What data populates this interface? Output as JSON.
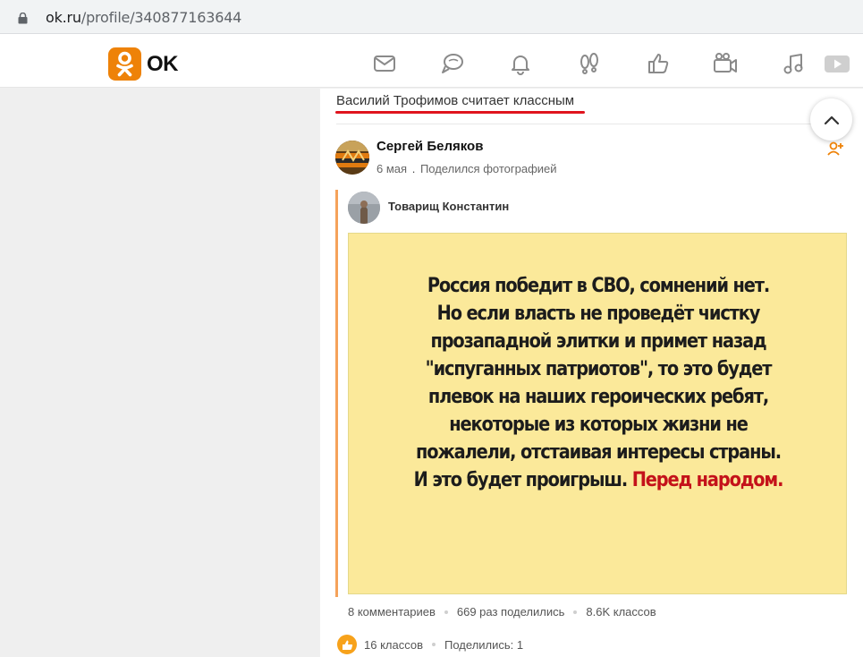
{
  "browser": {
    "url_host": "ok.ru",
    "url_path": "/profile/340877163644"
  },
  "header": {
    "logo_text": "OK",
    "nav_icons": [
      "mail-icon",
      "discussions-icon",
      "notifications-icon",
      "guests-icon",
      "events-icon",
      "video-call-icon",
      "music-icon",
      "video-icon"
    ]
  },
  "feed": {
    "liked_by_text": "Василий Трофимов считает классным",
    "post": {
      "author_name": "Сергей Беляков",
      "date": "6 мая",
      "action": "Поделился фотографией",
      "reshared_from": "Товарищ Константин",
      "photo_lines": [
        "Россия победит в СВО, сомнений нет.",
        "Но если власть не проведёт чистку",
        "прозападной элитки и примет назад",
        "\"испуганных патриотов\", то это будет",
        "плевок на наших героических ребят,",
        "некоторые из которых жизни не",
        "пожалели, отстаивая интересы страны.",
        "И это будет проигрыш."
      ],
      "photo_red_tail": "Перед народом.",
      "stats": {
        "comments": "8 комментариев",
        "shares": "669 раз поделились",
        "likes": "8.6K классов"
      },
      "actions": {
        "like_count": "16 классов",
        "share_count": "Поделились: 1"
      }
    }
  },
  "colors": {
    "ok_orange": "#ee8208",
    "underline_red": "#e0141e",
    "photo_bg": "#fbe99a",
    "photo_red": "#c4121a"
  }
}
